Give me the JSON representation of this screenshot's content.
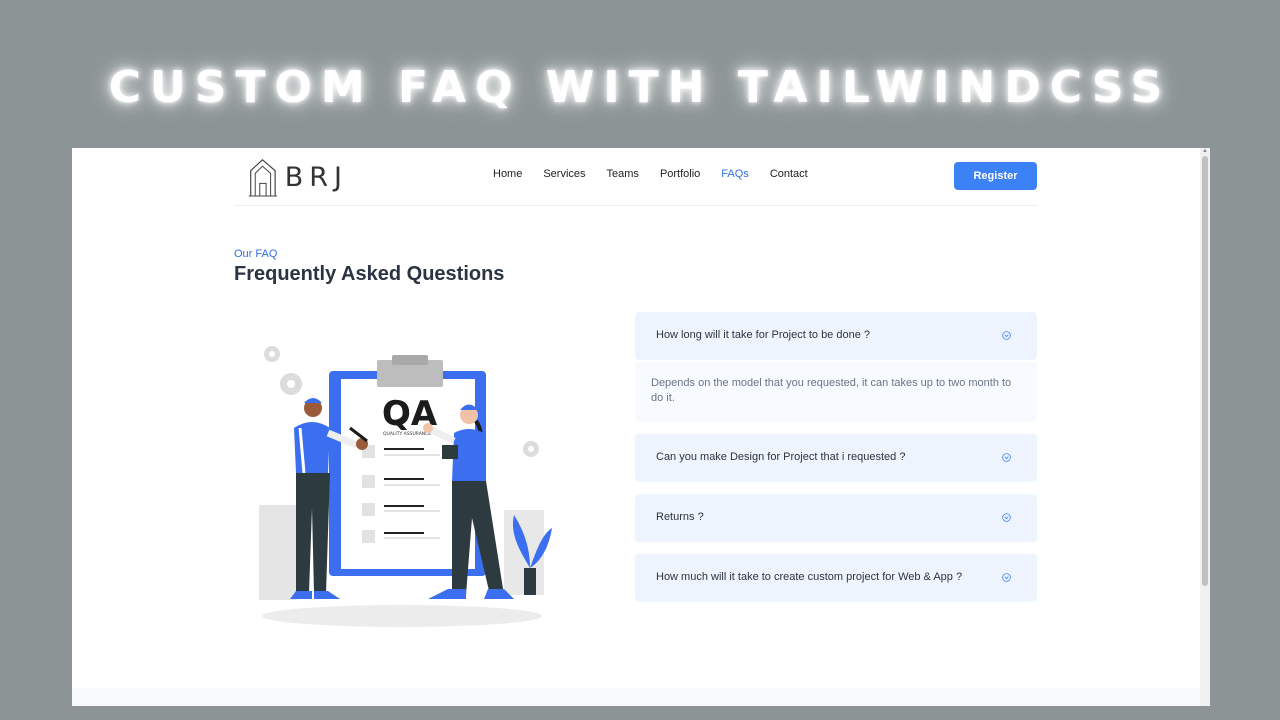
{
  "banner": {
    "title": "CUSTOM FAQ WITH TAILWINDCSS"
  },
  "header": {
    "logo_text": "BRJ",
    "nav": [
      {
        "label": "Home",
        "active": false
      },
      {
        "label": "Services",
        "active": false
      },
      {
        "label": "Teams",
        "active": false
      },
      {
        "label": "Portfolio",
        "active": false
      },
      {
        "label": "FAQs",
        "active": true
      },
      {
        "label": "Contact",
        "active": false
      }
    ],
    "register_label": "Register"
  },
  "section": {
    "eyebrow": "Our FAQ",
    "title": "Frequently Asked Questions"
  },
  "illustration": {
    "clipboard_heading": "QA",
    "clipboard_subtext": "QUALITY ASSURANCE"
  },
  "faq": [
    {
      "question": "How long will it take for Project to be done ?",
      "answer": "Depends on the model that you requested, it can takes up to two month to do it.",
      "expanded": true
    },
    {
      "question": "Can you make Design for Project that i requested ?",
      "expanded": false
    },
    {
      "question": "Returns ?",
      "expanded": false
    },
    {
      "question": "How much will it take to create custom project for Web & App ?",
      "expanded": false
    }
  ],
  "colors": {
    "accent": "#3b82f6",
    "faq_bg": "#eef4fe",
    "heading": "#2b3442",
    "outer_bg": "#8c9496"
  },
  "icons": [
    "chevron-down-icon",
    "house-logo-icon",
    "scroll-up-icon"
  ]
}
